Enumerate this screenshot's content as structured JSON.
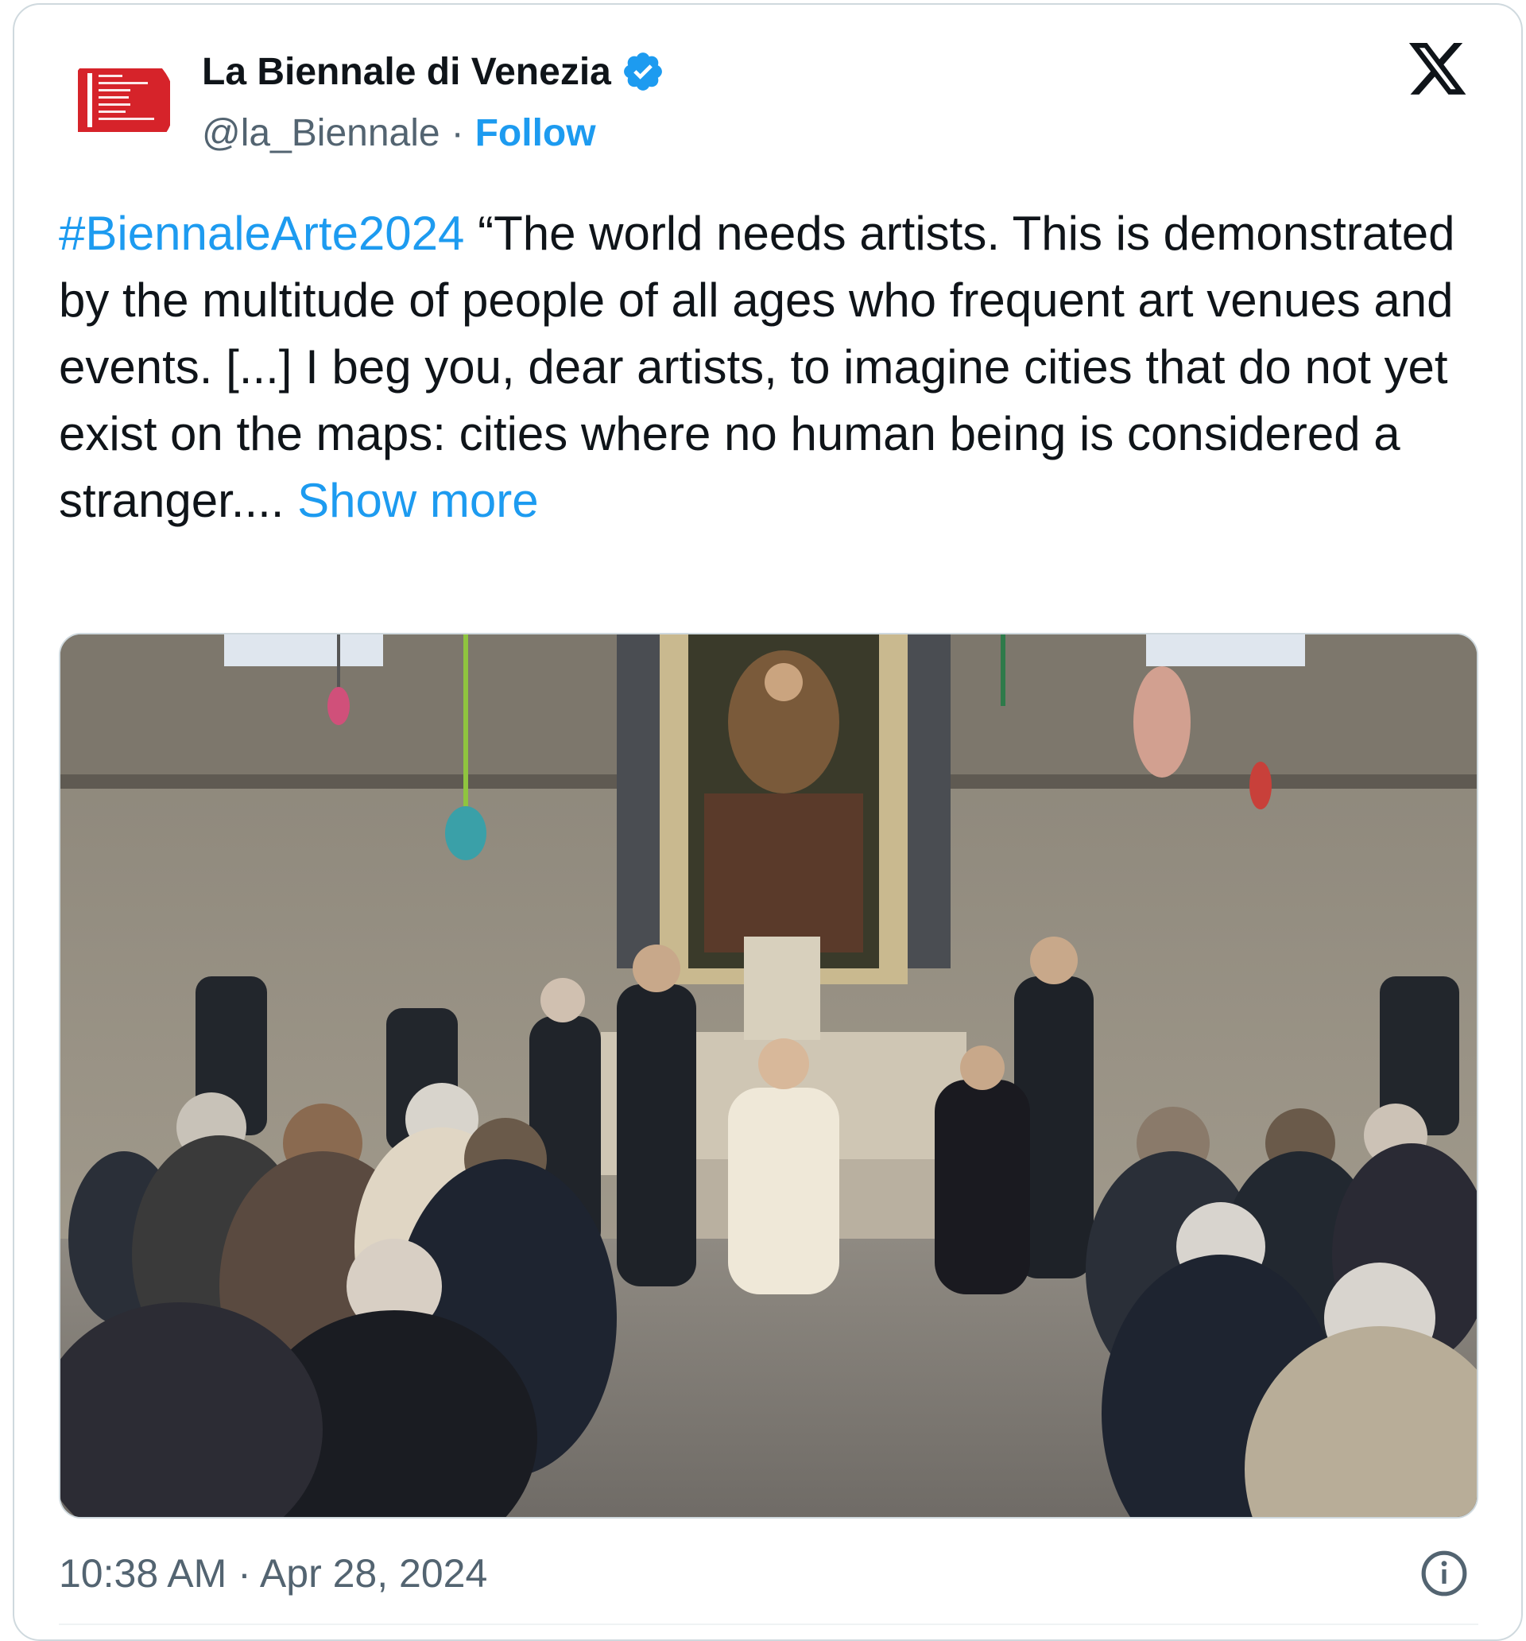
{
  "account": {
    "display_name": "La Biennale di Venezia",
    "handle": "@la_Biennale",
    "separator": "·",
    "follow_label": "Follow",
    "verified": true
  },
  "tweet": {
    "hashtag": "#BiennaleArte2024",
    "body": " “The world needs artists. This is demonstrated by the multitude of people of all ages who frequent art venues and events. [...] I beg you, dear artists, to imagine cities that do not yet exist on the maps: cities where no human being is considered a stranger.... ",
    "show_more_label": "Show more",
    "timestamp": "10:38 AM · Apr 28, 2024"
  },
  "media": {
    "kind": "photo"
  },
  "colors": {
    "accent": "#1d9bf0",
    "text": "#0f1419",
    "secondary": "#536471",
    "logo_red": "#d6232a"
  },
  "icons": [
    "verified-badge-icon",
    "x-logo-icon",
    "info-icon"
  ]
}
